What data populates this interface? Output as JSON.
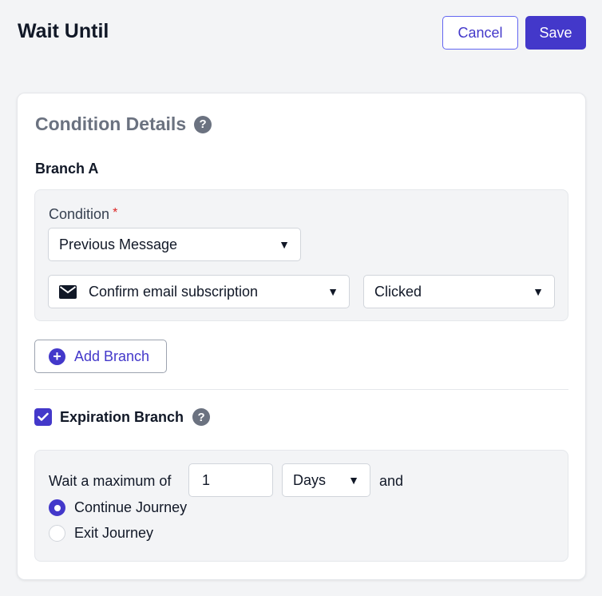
{
  "header": {
    "title": "Wait Until",
    "cancel_label": "Cancel",
    "save_label": "Save"
  },
  "condition_details": {
    "title": "Condition Details",
    "help_icon": "question-circle-icon",
    "branch_label": "Branch A",
    "condition_label": "Condition",
    "required_mark": "*",
    "condition_select": "Previous Message",
    "message_icon": "mail-icon",
    "message_select": "Confirm email subscription",
    "action_select": "Clicked",
    "add_branch_label": "Add Branch"
  },
  "expiration": {
    "label": "Expiration Branch",
    "checked": true,
    "wait_prefix": "Wait a maximum of",
    "amount": "1",
    "unit": "Days",
    "suffix": "and",
    "options": [
      {
        "label": "Continue Journey",
        "selected": true
      },
      {
        "label": "Exit Journey",
        "selected": false
      }
    ]
  },
  "colors": {
    "accent": "#4338ca",
    "required": "#dc2626",
    "background": "#f3f4f6"
  }
}
